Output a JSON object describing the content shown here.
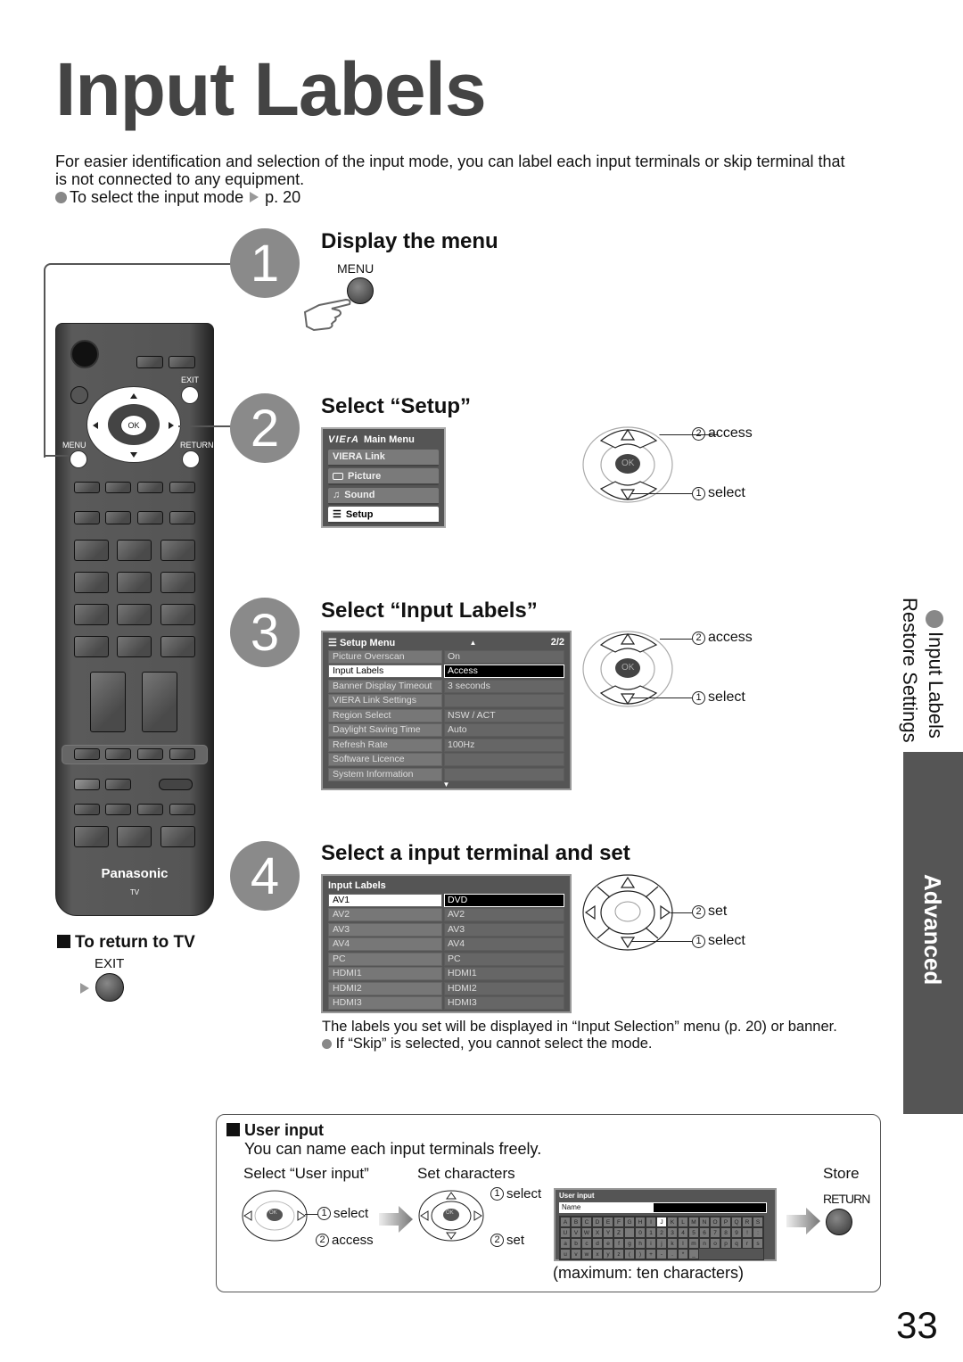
{
  "page": {
    "title": "Input Labels",
    "intro": "For easier identification and selection of the input mode, you can label each input terminals or skip terminal that is not connected to any equipment.",
    "intro_bullet_text": "To select the input mode",
    "intro_bullet_ref": "p. 20",
    "page_number": "33"
  },
  "remote": {
    "brand": "Panasonic",
    "model": "TV",
    "labels": {
      "exit": "EXIT",
      "menu": "MENU",
      "return": "RETURN",
      "ok": "OK"
    }
  },
  "return_to_tv": {
    "heading": "To return to TV",
    "button_label": "EXIT"
  },
  "steps": [
    {
      "number": "1",
      "heading": "Display the menu",
      "button_label": "MENU"
    },
    {
      "number": "2",
      "heading": "Select “Setup”"
    },
    {
      "number": "3",
      "heading": "Select “Input Labels”"
    },
    {
      "number": "4",
      "heading": "Select a input terminal and set"
    }
  ],
  "main_menu": {
    "title": "Main Menu",
    "logo": "VIErA",
    "items": [
      {
        "label": "VIERA Link",
        "icon": ""
      },
      {
        "label": "Picture",
        "icon": "picture-icon"
      },
      {
        "label": "Sound",
        "icon": "music-note-icon"
      },
      {
        "label": "Setup",
        "icon": "list-icon",
        "selected": true
      }
    ]
  },
  "setup_menu": {
    "title": "Setup Menu",
    "page": "2/2",
    "rows": [
      {
        "label": "Picture Overscan",
        "value": "On"
      },
      {
        "label": "Input Labels",
        "value": "Access",
        "selected": true
      },
      {
        "label": "Banner Display Timeout",
        "value": "3 seconds"
      },
      {
        "label": "VIERA Link Settings",
        "value": ""
      },
      {
        "label": "Region Select",
        "value": "NSW / ACT"
      },
      {
        "label": "Daylight Saving Time",
        "value": "Auto"
      },
      {
        "label": "Refresh Rate",
        "value": "100Hz"
      },
      {
        "label": "Software Licence",
        "value": ""
      },
      {
        "label": "System Information",
        "value": ""
      }
    ]
  },
  "input_labels_menu": {
    "title": "Input Labels",
    "rows": [
      {
        "label": "AV1",
        "value": "DVD",
        "selected": true
      },
      {
        "label": "AV2",
        "value": "AV2"
      },
      {
        "label": "AV3",
        "value": "AV3"
      },
      {
        "label": "AV4",
        "value": "AV4"
      },
      {
        "label": "PC",
        "value": "PC"
      },
      {
        "label": "HDMI1",
        "value": "HDMI1"
      },
      {
        "label": "HDMI2",
        "value": "HDMI2"
      },
      {
        "label": "HDMI3",
        "value": "HDMI3"
      }
    ]
  },
  "dpad_labels": {
    "ok": "OK",
    "step2": {
      "top": "access",
      "top_num": "2",
      "bottom": "select",
      "bottom_num": "1"
    },
    "step3": {
      "top": "access",
      "top_num": "2",
      "bottom": "select",
      "bottom_num": "1"
    },
    "step4": {
      "top": "set",
      "top_num": "2",
      "bottom": "select",
      "bottom_num": "1"
    }
  },
  "step4_notes": {
    "line1": "The labels you set will be displayed in “Input Selection” menu (p. 20) or banner.",
    "bullet": "If “Skip” is selected, you cannot select the mode."
  },
  "side_tab": {
    "current": "Input Labels",
    "next": "Restore Settings",
    "section": "Advanced"
  },
  "user_input": {
    "heading": "User input",
    "description": "You can name each input terminals freely.",
    "col1": "Select “User input”",
    "col2": "Set characters",
    "col3": "Store",
    "a_select": "select",
    "a_select_num": "1",
    "a_access": "access",
    "a_access_num": "2",
    "b_select": "select",
    "b_select_num": "1",
    "b_set": "set",
    "b_set_num": "2",
    "return_label": "RETURN",
    "max_note": "(maximum: ten characters)",
    "ok": "OK",
    "screen": {
      "title": "User input",
      "name_label": "Name",
      "keys": [
        [
          "A",
          "B",
          "C",
          "D",
          "E",
          "F",
          "G",
          "H",
          "I",
          "J",
          "K",
          "L",
          "M",
          "N",
          "O",
          "P",
          "Q",
          "R",
          "S",
          "T"
        ],
        [
          "U",
          "V",
          "W",
          "X",
          "Y",
          "Z",
          " ",
          "0",
          "1",
          "2",
          "3",
          "4",
          "5",
          "6",
          "7",
          "8",
          "9",
          "!",
          ":",
          "#"
        ],
        [
          "a",
          "b",
          "c",
          "d",
          "e",
          "f",
          "g",
          "h",
          "i",
          "j",
          "k",
          "l",
          "m",
          "n",
          "o",
          "p",
          "q",
          "r",
          "s",
          "t"
        ],
        [
          "u",
          "v",
          "w",
          "x",
          "y",
          "z",
          "(",
          ")",
          "+",
          "-",
          ".",
          "*",
          "_"
        ]
      ],
      "selected_key": "J"
    }
  }
}
